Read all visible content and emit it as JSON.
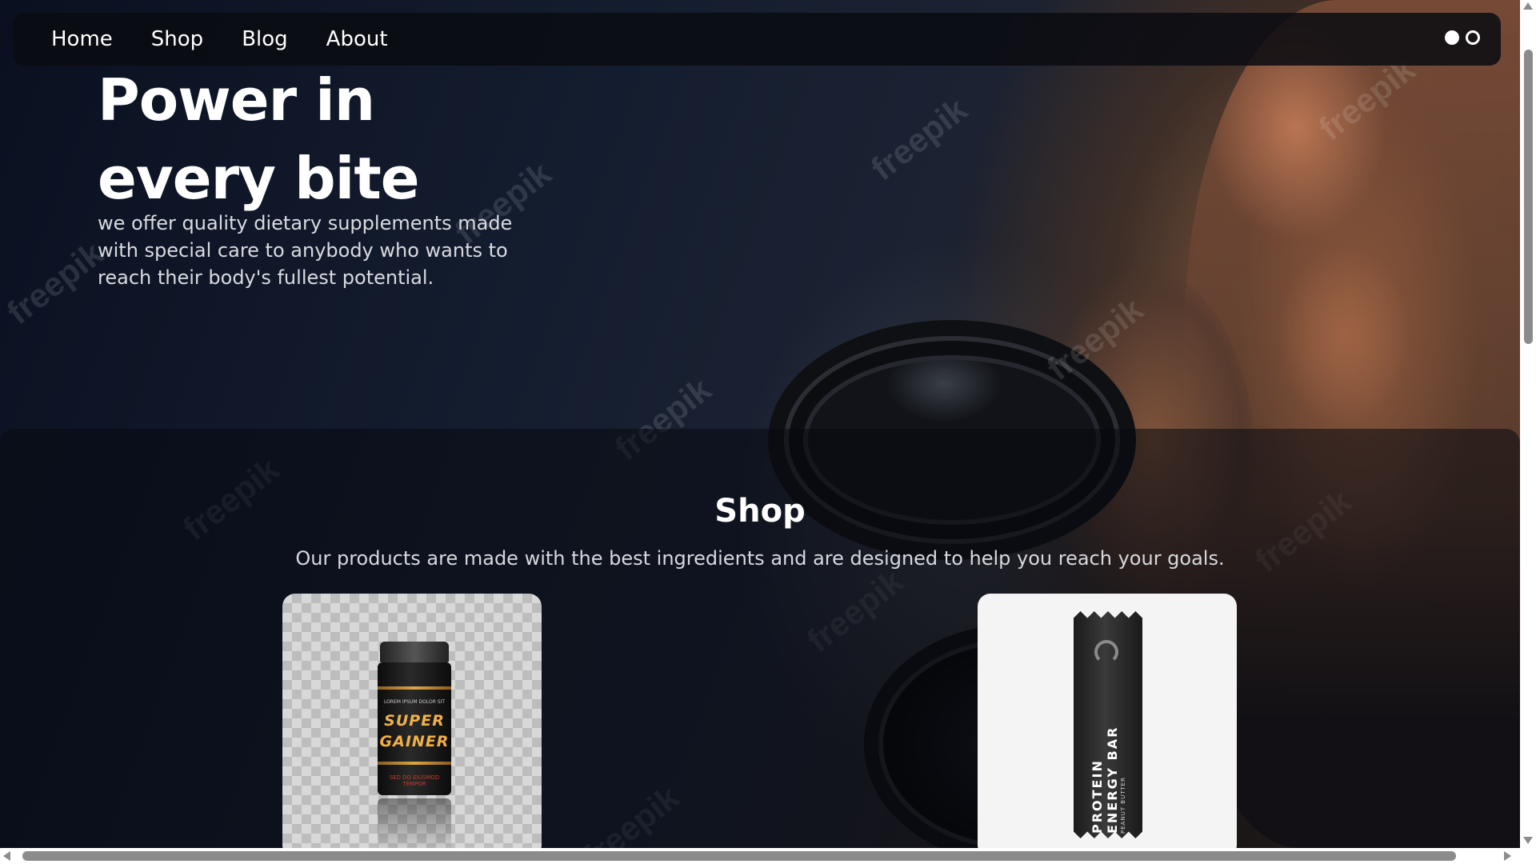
{
  "nav": {
    "items": [
      {
        "label": "Home"
      },
      {
        "label": "Shop"
      },
      {
        "label": "Blog"
      },
      {
        "label": "About"
      }
    ]
  },
  "hero": {
    "title_line1": "Power in",
    "title_line2": "every bite",
    "text": "we offer quality dietary supplements made with special care to anybody who wants to reach their body's fullest potential."
  },
  "background": {
    "watermark_text": "freepik"
  },
  "shop": {
    "title": "Shop",
    "subtitle": "Our products are made with the best ingredients and are designed to help you reach your goals.",
    "products": [
      {
        "small_text": "LOREM IPSUM DOLOR SIT",
        "word1": "SUPER",
        "word2": "GAINER",
        "red_text": "SED DO EIUSMOD TEMPOR"
      },
      {
        "line1": "PROTEIN",
        "line2": "ENERGY BAR",
        "small_text": "PEANUT BUTTER"
      }
    ]
  },
  "colors": {
    "nav_bg": "#0a0c12",
    "text_primary": "#ffffff",
    "accent_gold": "#f1b04a"
  }
}
